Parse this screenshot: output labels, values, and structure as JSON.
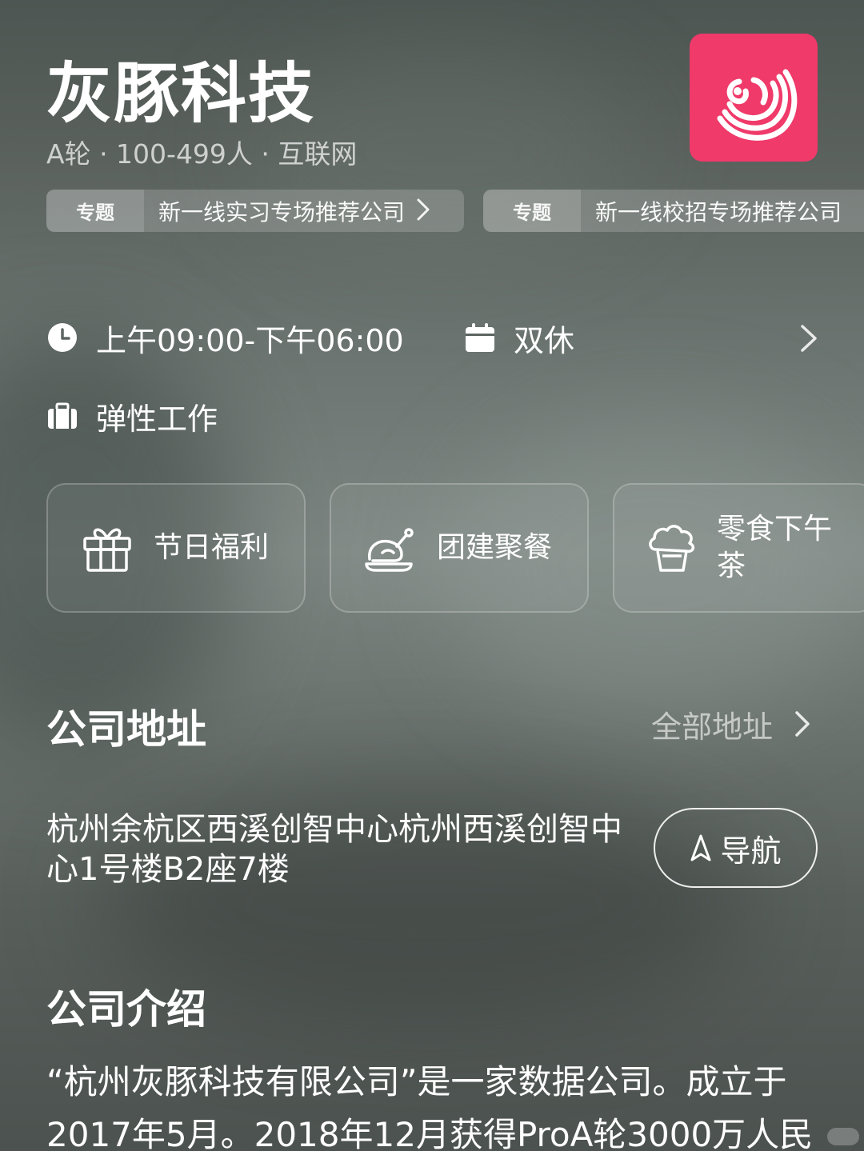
{
  "company": {
    "name": "灰豚科技",
    "meta": "A轮 · 100-499人 · 互联网",
    "logo_color": "#ef3a6a"
  },
  "topics": [
    {
      "label": "专题",
      "text": "新一线实习专场推荐公司"
    },
    {
      "label": "专题",
      "text": "新一线校招专场推荐公司"
    }
  ],
  "work_info": {
    "hours": "上午09:00-下午06:00",
    "rest": "双休",
    "mode": "弹性工作"
  },
  "benefits": [
    {
      "label": "节日福利",
      "icon": "gift-icon"
    },
    {
      "label": "团建聚餐",
      "icon": "roast-chicken-icon"
    },
    {
      "label": "零食下午茶",
      "icon": "cupcake-icon"
    }
  ],
  "address_section": {
    "title": "公司地址",
    "all_link": "全部地址",
    "address": "杭州余杭区西溪创智中心杭州西溪创智中心1号楼B2座7楼",
    "nav_label": "导航"
  },
  "intro_section": {
    "title": "公司介绍",
    "text": "“杭州灰豚科技有限公司”是一家数据公司。成立于2017年5月。2018年12月获得ProA轮3000万人民"
  }
}
